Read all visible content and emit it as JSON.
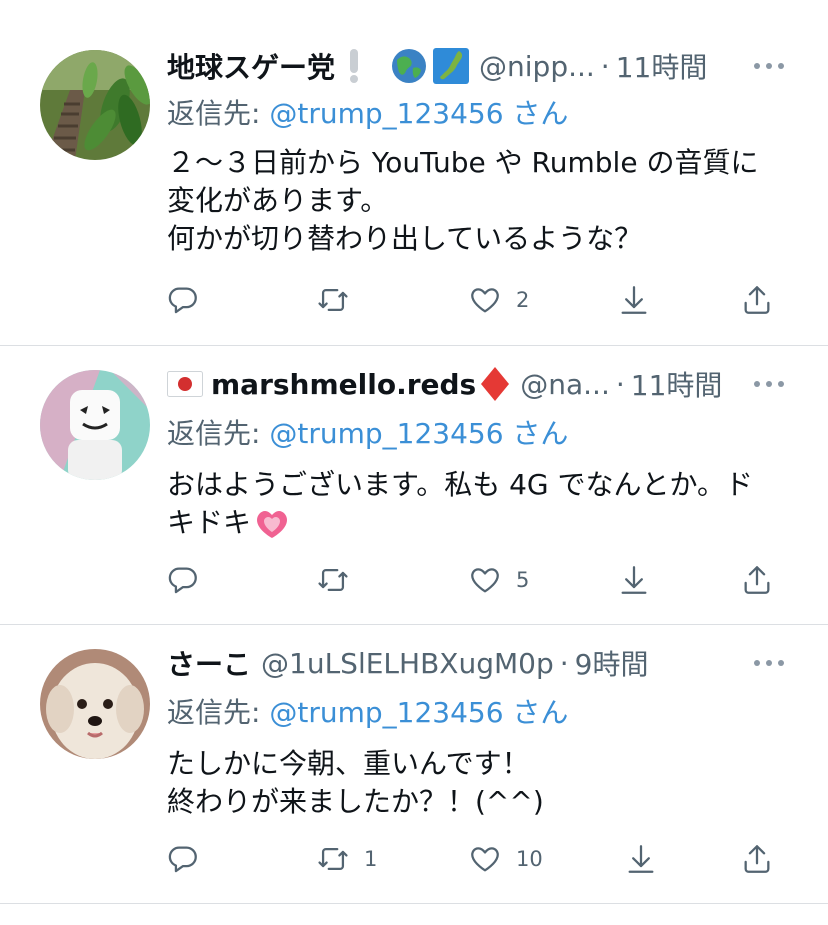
{
  "tweets": [
    {
      "name": "地球スゲー党",
      "badges": [
        "❕",
        "🌏",
        "🗾"
      ],
      "handle": "@nipp...",
      "dot": "·",
      "time": "11時間",
      "reply_prefix": "返信先: ",
      "reply_mention": "@trump_123456",
      "reply_suffix": "さん",
      "text": "２～３日前から YouTube や Rumble の音質に\n変化があります。\n何かが切り替わり出しているような？",
      "replies": "",
      "retweets": "",
      "likes": "2",
      "avatar_icon": "plant-photo-avatar"
    },
    {
      "name": "marshmello.reds",
      "flag": "🇯🇵",
      "badge_after": "♦",
      "handle": "@na...",
      "dot": "·",
      "time": "11時間",
      "reply_prefix": "返信先: ",
      "reply_mention": "@trump_123456",
      "reply_suffix": "さん",
      "text": "おはようございます。私も 4G でなんとか。ド\nキドキ",
      "text_emoji": "💓",
      "replies": "",
      "retweets": "",
      "likes": "5",
      "avatar_icon": "marshmello-avatar"
    },
    {
      "name": "さーこ",
      "handle": "@1uLSlELHBXugM0p",
      "dot": "·",
      "time": "9時間",
      "reply_prefix": "返信先: ",
      "reply_mention": "@trump_123456",
      "reply_suffix": "さん",
      "text": "たしかに今朝、重いんです！\n終わりが来ましたか？！(^^)",
      "replies": "",
      "retweets": "1",
      "likes": "10",
      "avatar_icon": "dog-photo-avatar"
    }
  ],
  "icons": {
    "reply": "reply-icon",
    "retweet": "retweet-icon",
    "like": "heart-icon",
    "download": "download-icon",
    "share": "share-icon",
    "more": "more-icon"
  },
  "colors": {
    "mention": "#3b8fd6",
    "secondary": "#536471",
    "divider": "#dcdfe3"
  }
}
